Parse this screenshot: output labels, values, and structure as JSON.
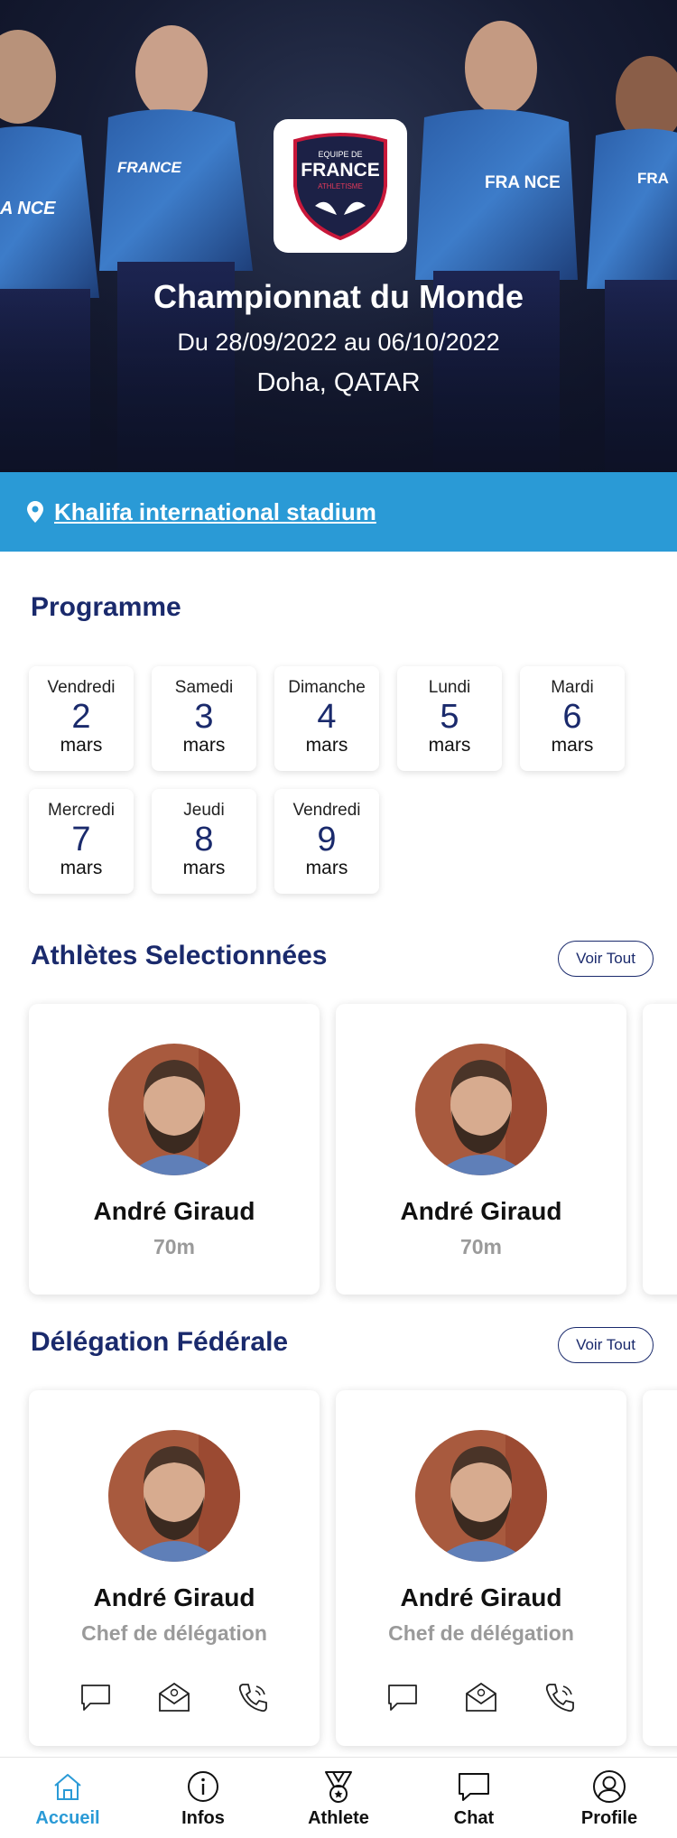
{
  "hero": {
    "logo_text_top": "EQUIPE DE",
    "logo_text_main": "FRANCE",
    "logo_text_sub": "ATHLETISME",
    "title": "Championnat du Monde",
    "dates": "Du 28/09/2022 au 06/10/2022",
    "place": "Doha, QATAR",
    "shirt_texts": [
      "A NCE",
      "FRANCE",
      "FRA NCE",
      "FRA"
    ]
  },
  "venue": {
    "label": "Khalifa international stadium"
  },
  "programme": {
    "title": "Programme",
    "days": [
      {
        "day": "Vendredi",
        "date": "2",
        "month": "mars"
      },
      {
        "day": "Samedi",
        "date": "3",
        "month": "mars"
      },
      {
        "day": "Dimanche",
        "date": "4",
        "month": "mars"
      },
      {
        "day": "Lundi",
        "date": "5",
        "month": "mars"
      },
      {
        "day": "Mardi",
        "date": "6",
        "month": "mars"
      },
      {
        "day": "Mercredi",
        "date": "7",
        "month": "mars"
      },
      {
        "day": "Jeudi",
        "date": "8",
        "month": "mars"
      },
      {
        "day": "Vendredi",
        "date": "9",
        "month": "mars"
      }
    ]
  },
  "athletes": {
    "title": "Athlètes Selectionnées",
    "see_all": "Voir Tout",
    "items": [
      {
        "name": "André Giraud",
        "detail": "70m"
      },
      {
        "name": "André Giraud",
        "detail": "70m"
      }
    ]
  },
  "delegation": {
    "title": "Délégation Fédérale",
    "see_all": "Voir Tout",
    "items": [
      {
        "name": "André Giraud",
        "role": "Chef de délégation"
      },
      {
        "name": "André Giraud",
        "role": "Chef de délégation"
      }
    ]
  },
  "nav": {
    "items": [
      {
        "label": "Accueil",
        "icon": "home-icon",
        "active": true
      },
      {
        "label": "Infos",
        "icon": "info-icon"
      },
      {
        "label": "Athlete",
        "icon": "medal-icon"
      },
      {
        "label": "Chat",
        "icon": "chat-icon"
      },
      {
        "label": "Profile",
        "icon": "user-icon"
      }
    ]
  },
  "colors": {
    "navy": "#1a2a6c",
    "accent_blue": "#2a9ad6",
    "muted": "#9a9a9a"
  }
}
